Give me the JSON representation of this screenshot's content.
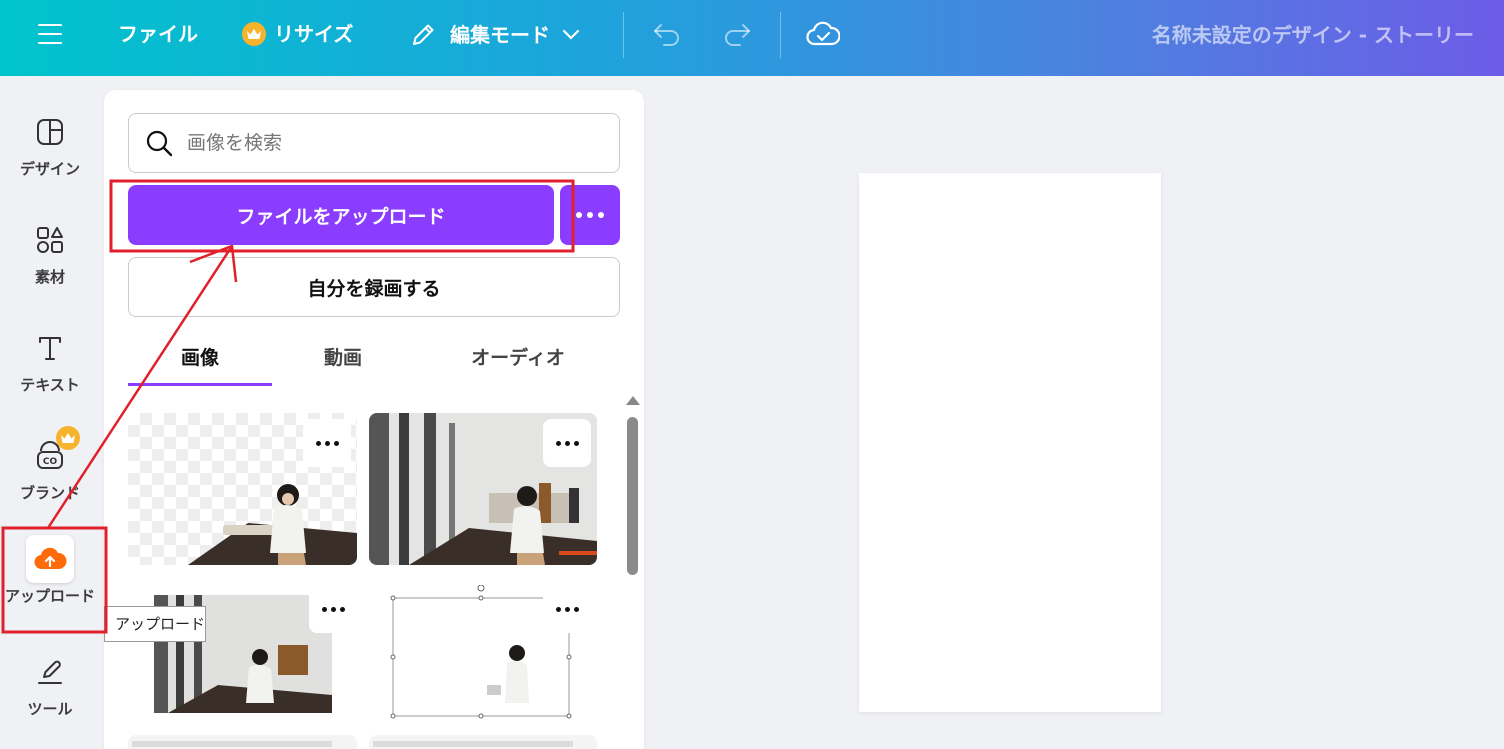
{
  "header": {
    "file_label": "ファイル",
    "resize_label": "リサイズ",
    "edit_mode_label": "編集モード",
    "design_title": "名称未設定のデザイン - ストーリー"
  },
  "nav": {
    "items": [
      {
        "label": "デザイン",
        "icon": "layout-icon"
      },
      {
        "label": "素材",
        "icon": "shapes-icon"
      },
      {
        "label": "テキスト",
        "icon": "text-icon"
      },
      {
        "label": "ブランド",
        "icon": "brand-icon"
      },
      {
        "label": "アップロード",
        "icon": "cloud-upload-icon"
      },
      {
        "label": "ツール",
        "icon": "draw-tool-icon"
      }
    ],
    "tooltip": "アップロード"
  },
  "panel": {
    "search_placeholder": "画像を検索",
    "upload_button": "ファイルをアップロード",
    "record_button": "自分を録画する",
    "tabs": [
      "画像",
      "動画",
      "オーディオ"
    ],
    "active_tab": "画像"
  },
  "colors": {
    "accent": "#8b3dff",
    "header_start": "#00c4cc",
    "header_end": "#6c5ce7",
    "annotation": "#e0202a",
    "crown": "#f7b32b",
    "upload_icon": "#ff6b0a"
  }
}
